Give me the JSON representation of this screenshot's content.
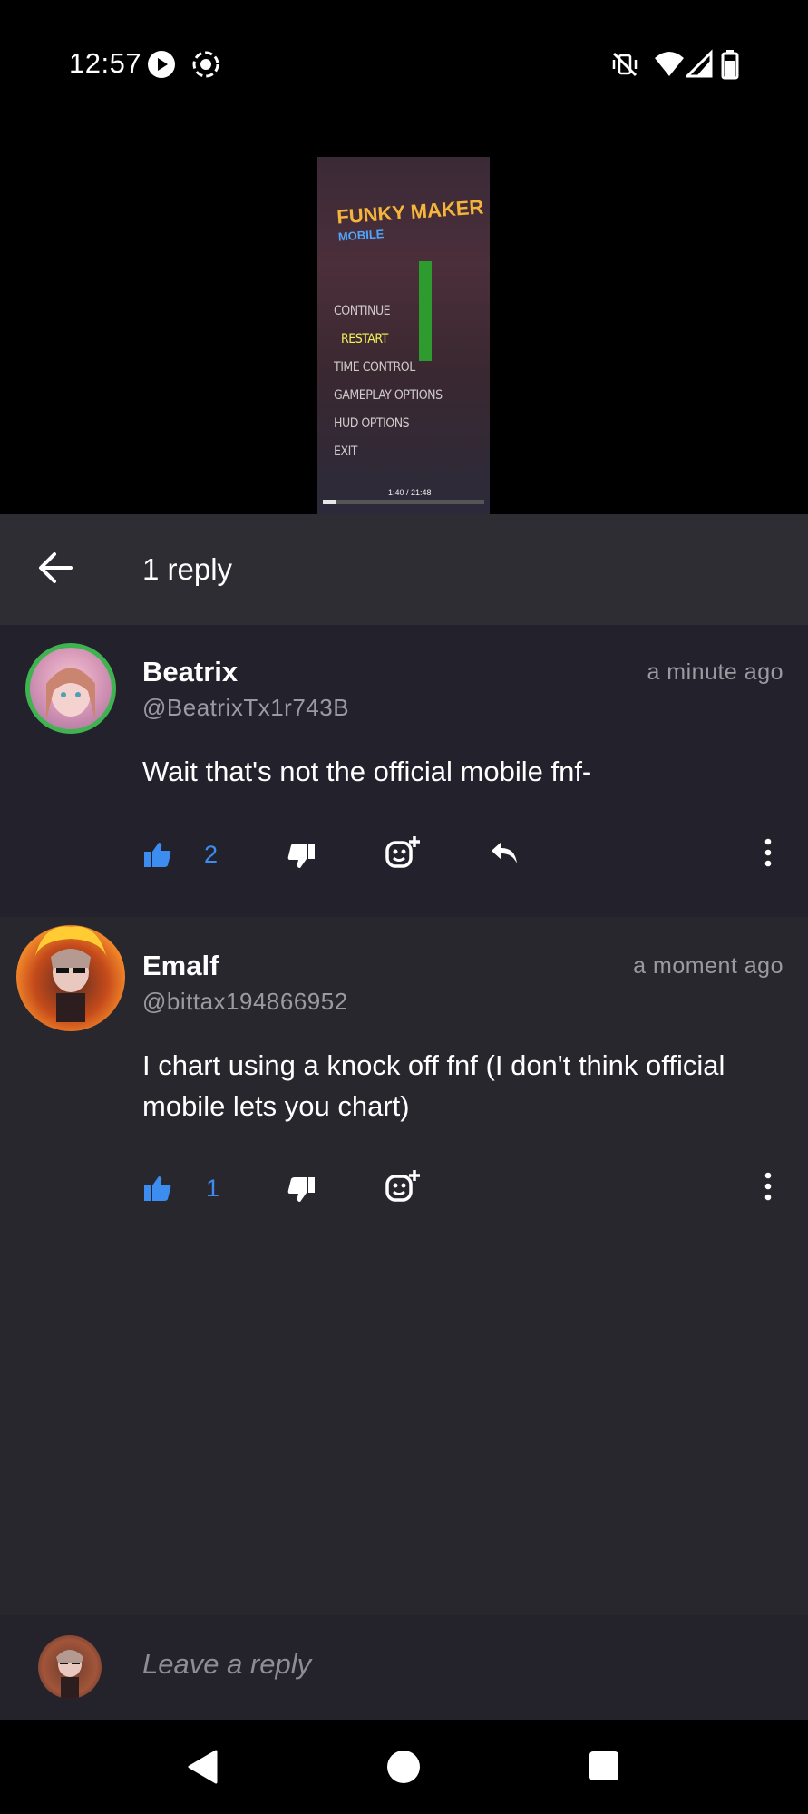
{
  "status_bar": {
    "time": "12:57",
    "left_icons": [
      "play-circle-icon",
      "record-icon"
    ],
    "right_icons": [
      "vibrate-off-icon",
      "wifi-icon",
      "signal-icon",
      "battery-icon"
    ]
  },
  "video": {
    "menu_items": [
      "CONTINUE",
      "RESTART",
      "TIME CONTROL",
      "GAMEPLAY OPTIONS",
      "HUD OPTIONS",
      "EXIT"
    ],
    "selected_item": "RESTART",
    "logo_title": "FUNKY MAKER",
    "logo_subtitle": "MOBILE",
    "timestamp": "1:40 / 21:48",
    "progress": 0.08
  },
  "header": {
    "title": "1 reply"
  },
  "comments": [
    {
      "name": "Beatrix",
      "handle": "@BeatrixTx1r743B",
      "time": "a minute ago",
      "text": "Wait that's not the official mobile fnf-",
      "likes": "2"
    },
    {
      "name": "Emalf",
      "handle": "@bittax194866952",
      "time": "a moment ago",
      "text": "I chart using a knock off fnf (I don't think official mobile lets you chart)",
      "likes": "1"
    }
  ],
  "reply_box": {
    "placeholder": "Leave a reply"
  },
  "colors": {
    "accent": "#3d8cf0",
    "header_bg": "#2e2d33",
    "comment_bg": "#23222c",
    "page_bg": "#28272e"
  }
}
